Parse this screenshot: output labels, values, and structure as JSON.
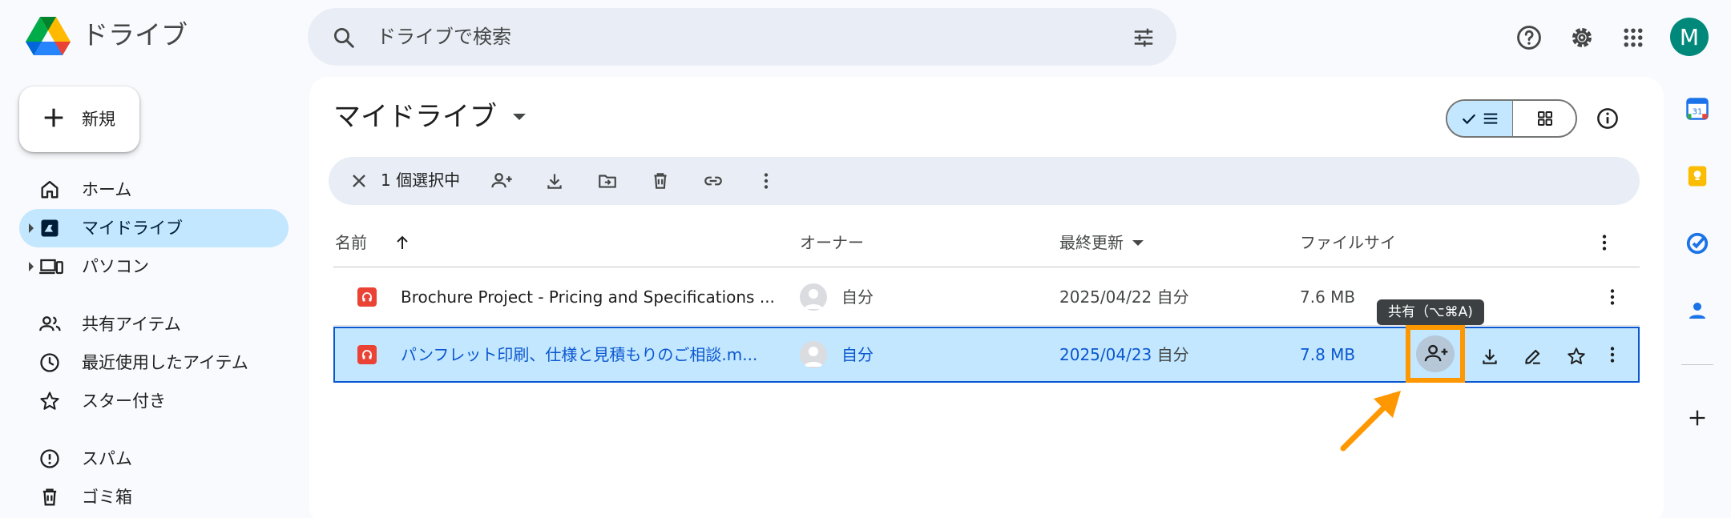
{
  "header": {
    "app_title": "ドライブ",
    "search_placeholder": "ドライブで検索",
    "avatar_letter": "M",
    "icons": [
      "drive-logo",
      "search-icon",
      "filter-icon",
      "help-icon",
      "settings-icon",
      "apps-icon"
    ]
  },
  "sidebar": {
    "new_label": "新規",
    "items": [
      {
        "label": "ホーム",
        "icon": "home-icon"
      },
      {
        "label": "マイドライブ",
        "icon": "my-drive-icon",
        "active": true
      },
      {
        "label": "パソコン",
        "icon": "computers-icon"
      },
      {
        "label": "共有アイテム",
        "icon": "shared-icon"
      },
      {
        "label": "最近使用したアイテム",
        "icon": "recent-icon"
      },
      {
        "label": "スター付き",
        "icon": "star-icon"
      },
      {
        "label": "スパム",
        "icon": "spam-icon"
      },
      {
        "label": "ゴミ箱",
        "icon": "trash-icon"
      }
    ]
  },
  "main": {
    "title": "マイドライブ",
    "selection": {
      "count_label": "1 個選択中"
    },
    "columns": {
      "name": "名前",
      "owner": "オーナー",
      "modified": "最終更新",
      "size": "ファイルサイ"
    },
    "rows": [
      {
        "name": "Brochure Project - Pricing and Specifications ...",
        "owner": "自分",
        "date": "2025/04/22",
        "modified_by": "自分",
        "size": "7.6 MB",
        "selected": false
      },
      {
        "name": "パンフレット印刷、仕様と見積もりのご相談.m...",
        "owner": "自分",
        "date": "2025/04/23",
        "modified_by": "自分",
        "size": "7.8 MB",
        "selected": true
      }
    ],
    "tooltip": "共有（⌥⌘A)"
  },
  "colors": {
    "accent": "#0b57d0",
    "selected_bg": "#c2e7ff",
    "highlight": "#ff9800",
    "file_icon": "#ea4335"
  }
}
